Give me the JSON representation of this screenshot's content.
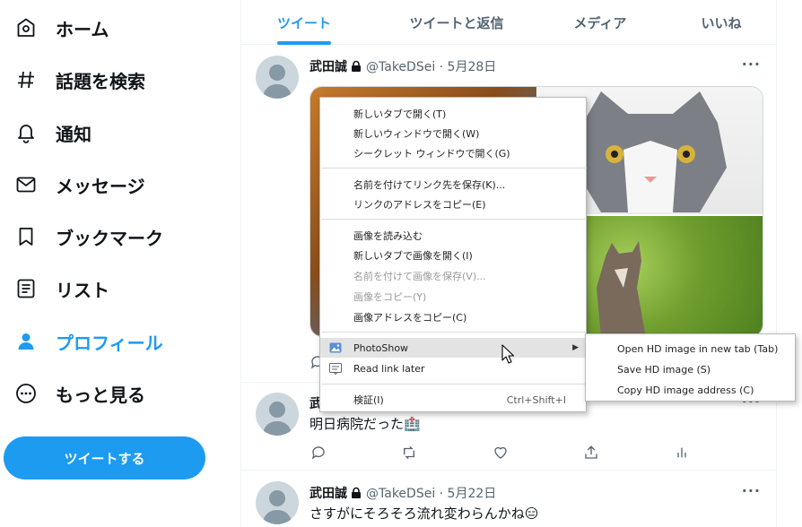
{
  "nav": {
    "items": [
      {
        "label": "ホーム",
        "icon": "home-icon"
      },
      {
        "label": "話題を検索",
        "icon": "hashtag-icon"
      },
      {
        "label": "通知",
        "icon": "bell-icon"
      },
      {
        "label": "メッセージ",
        "icon": "envelope-icon"
      },
      {
        "label": "ブックマーク",
        "icon": "bookmark-icon"
      },
      {
        "label": "リスト",
        "icon": "list-icon"
      },
      {
        "label": "プロフィール",
        "icon": "person-icon"
      },
      {
        "label": "もっと見る",
        "icon": "more-circle-icon"
      }
    ],
    "tweet_button": "ツイートする"
  },
  "tabs": [
    "ツイート",
    "ツイートと返信",
    "メディア",
    "いいね"
  ],
  "tweets": [
    {
      "name": "武田誠",
      "handle": "@TakeDSei · 5月28日",
      "more": "···"
    },
    {
      "name": "武",
      "text": "明日病院だった🏥",
      "more": "···"
    },
    {
      "name": "武田誠",
      "handle": "@TakeDSei · 5月22日",
      "text": "さすがにそろそろ流れ変わらんかね😑",
      "more": "···"
    }
  ],
  "context_menu": {
    "items": [
      "新しいタブで開く(T)",
      "新しいウィンドウで開く(W)",
      "シークレット ウィンドウで開く(G)",
      "名前を付けてリンク先を保存(K)...",
      "リンクのアドレスをコピー(E)",
      "画像を読み込む",
      "新しいタブで画像を開く(I)",
      "名前を付けて画像を保存(V)...",
      "画像をコピー(Y)",
      "画像アドレスをコピー(C)",
      "PhotoShow",
      "Read link later",
      "検証(I)"
    ],
    "inspect_shortcut": "Ctrl+Shift+I"
  },
  "submenu": {
    "items": [
      "Open HD image in new tab (Tab)",
      "Save HD image (S)",
      "Copy HD image address (C)"
    ]
  },
  "colors": {
    "accent": "#1d9bf0",
    "text": "#0f1419",
    "muted": "#536471",
    "menu_highlight": "#e3e3e3"
  }
}
